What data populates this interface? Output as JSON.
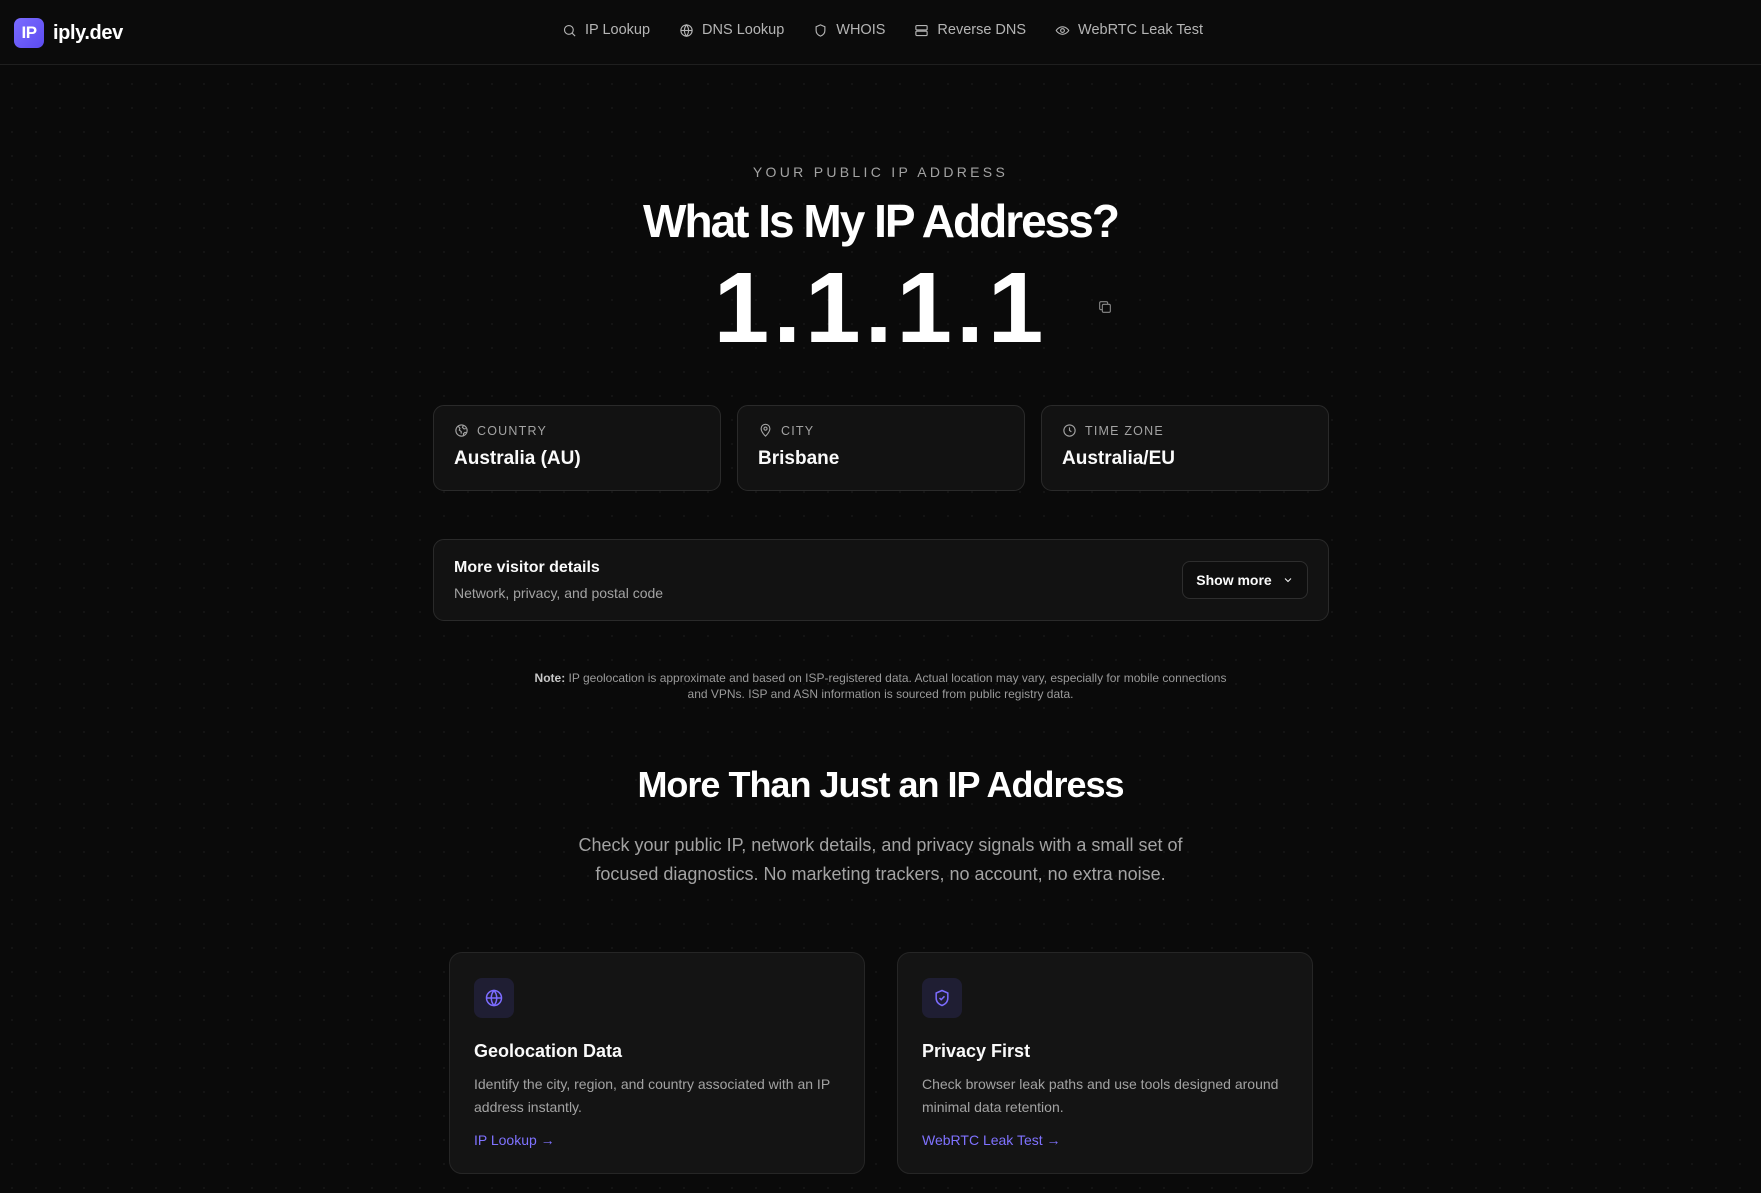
{
  "header": {
    "logo_mark": "IP",
    "logo_text": "iply.dev",
    "nav": [
      {
        "label": "IP Lookup",
        "icon": "search-icon"
      },
      {
        "label": "DNS Lookup",
        "icon": "globe-icon"
      },
      {
        "label": "WHOIS",
        "icon": "shield-icon"
      },
      {
        "label": "Reverse DNS",
        "icon": "server-icon"
      },
      {
        "label": "WebRTC Leak Test",
        "icon": "eye-icon"
      }
    ]
  },
  "hero": {
    "eyebrow": "YOUR PUBLIC IP ADDRESS",
    "title": "What Is My IP Address?",
    "ip": "1.1.1.1",
    "copy_icon": "copy-icon"
  },
  "info_cards": [
    {
      "label": "COUNTRY",
      "value": "Australia (AU)",
      "icon": "globe-icon"
    },
    {
      "label": "CITY",
      "value": "Brisbane",
      "icon": "map-pin-icon"
    },
    {
      "label": "TIME ZONE",
      "value": "Australia/EU",
      "icon": "clock-icon"
    }
  ],
  "details": {
    "title": "More visitor details",
    "subtitle": "Network, privacy, and postal code",
    "button_label": "Show more"
  },
  "note": {
    "prefix": "Note:",
    "text": " IP geolocation is approximate and based on ISP-registered data. Actual location may vary, especially for mobile connections and VPNs. ISP and ASN information is sourced from public registry data."
  },
  "section": {
    "title": "More Than Just an IP Address",
    "subtitle": "Check your public IP, network details, and privacy signals with a small set of focused diagnostics. No marketing trackers, no account, no extra noise."
  },
  "features": [
    {
      "title": "Geolocation Data",
      "description": "Identify the city, region, and country associated with an IP address instantly.",
      "link": "IP Lookup →",
      "icon": "globe-icon"
    },
    {
      "title": "Privacy First",
      "description": "Check browser leak paths and use tools designed around minimal data retention.",
      "link": "WebRTC Leak Test →",
      "icon": "shield-check-icon"
    }
  ],
  "colors": {
    "background": "#0a0a0a",
    "accent": "#7c6cff",
    "card": "#121212",
    "border": "#2a2a2a"
  }
}
